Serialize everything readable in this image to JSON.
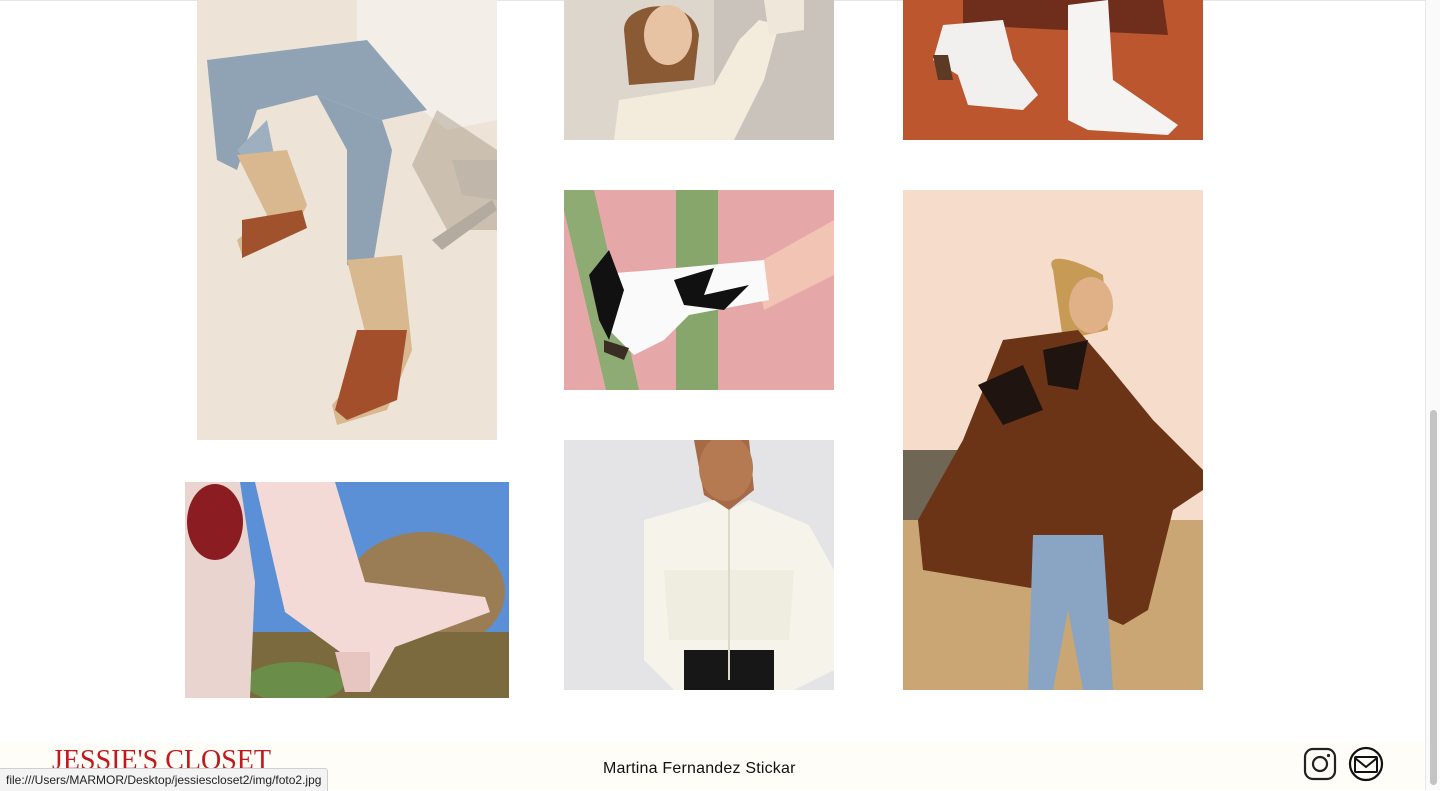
{
  "gallery": {
    "photos": [
      {
        "alt": "jeans and western boots"
      },
      {
        "alt": "woman in cream blouse"
      },
      {
        "alt": "white boots on red dirt"
      },
      {
        "alt": "black and white boot against pink wall with cactus"
      },
      {
        "alt": "pink cowboy boot under blue sky"
      },
      {
        "alt": "woman in white fringe shirt"
      },
      {
        "alt": "woman in fringe suede jacket"
      }
    ]
  },
  "footer": {
    "logo_text": "JESSIE'S CLOSET",
    "author": "Martina Fernandez Stickar",
    "icons": [
      "instagram-icon",
      "mail-icon"
    ]
  },
  "statusbar": {
    "url": "file:///Users/MARMOR/Desktop/jessiescloset2/img/foto2.jpg"
  },
  "colors": {
    "brand_red": "#c2181f",
    "footer_bg": "#fffdf8"
  }
}
